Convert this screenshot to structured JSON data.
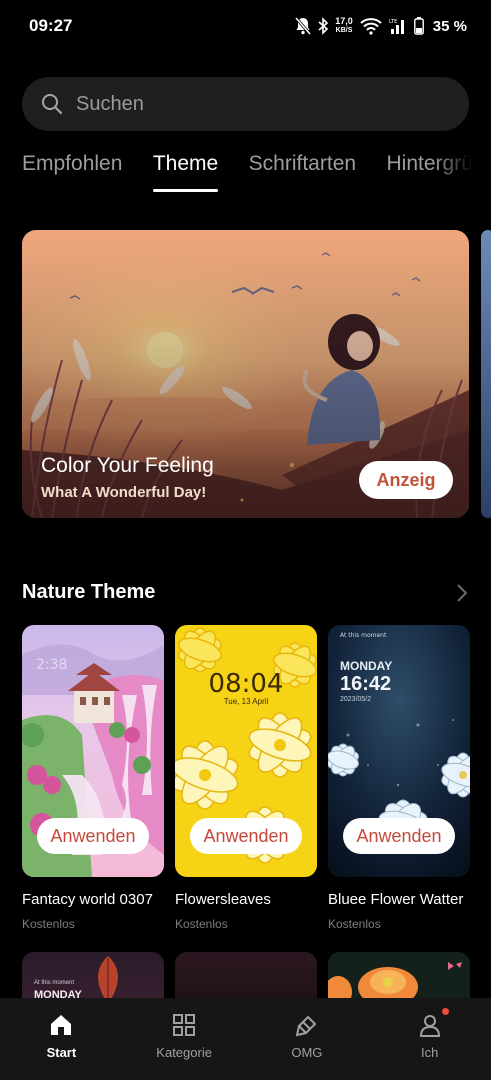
{
  "status": {
    "time": "09:27",
    "net_speed_value": "17,0",
    "net_speed_unit": "KB/S",
    "battery": "35 %"
  },
  "search": {
    "placeholder": "Suchen",
    "icon": "search-icon"
  },
  "tabs": [
    {
      "label": "Empfohlen"
    },
    {
      "label": "Theme"
    },
    {
      "label": "Schriftarten"
    },
    {
      "label": "Hintergrü"
    }
  ],
  "banner": {
    "title": "Color Your Feeling",
    "subtitle": "What A Wonderful Day!",
    "button": "Anzeig"
  },
  "section": {
    "title": "Nature Theme"
  },
  "cards": [
    {
      "name": "Fantacy world 0307",
      "price": "Kostenlos",
      "button": "Anwenden",
      "clock_time": "",
      "clock_date": ""
    },
    {
      "name": "Flowersleaves",
      "price": "Kostenlos",
      "button": "Anwenden",
      "clock_time": "08:04",
      "clock_date": "Tue, 13 April"
    },
    {
      "name": "Bluee Flower Watter",
      "price": "Kostenlos",
      "button": "Anwenden",
      "clock_day": "MONDAY",
      "clock_time": "16:42",
      "clock_date": "2023/05/2",
      "moment": "At this moment"
    }
  ],
  "row2": {
    "moment": "At this moment",
    "day": "MONDAY"
  },
  "nav": [
    {
      "label": "Start",
      "icon": "home-icon"
    },
    {
      "label": "Kategorie",
      "icon": "grid-icon"
    },
    {
      "label": "OMG",
      "icon": "brush-icon"
    },
    {
      "label": "Ich",
      "icon": "user-icon"
    }
  ],
  "colors": {
    "accent": "#c4493a",
    "background": "#000000",
    "nav_bg": "#161616"
  }
}
